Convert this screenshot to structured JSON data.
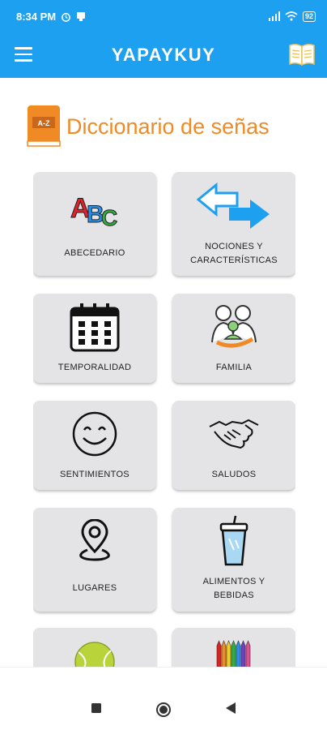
{
  "status_bar": {
    "time": "8:34 PM",
    "battery": "92"
  },
  "app_bar": {
    "title": "YAPAYKUY"
  },
  "header": {
    "title": "Diccionario de señas",
    "book_icon_text": "A-Z"
  },
  "cards": [
    {
      "label": "ABECEDARIO",
      "icon": "abc-letters-icon"
    },
    {
      "label_lines": [
        "NOCIONES Y",
        "CARACTERÍSTICAS"
      ],
      "icon": "arrows-exchange-icon"
    },
    {
      "label": "TEMPORALIDAD",
      "icon": "calendar-icon"
    },
    {
      "label": "FAMILIA",
      "icon": "family-icon"
    },
    {
      "label": "SENTIMIENTOS",
      "icon": "smiley-icon"
    },
    {
      "label": "SALUDOS",
      "icon": "handshake-icon"
    },
    {
      "label": "LUGARES",
      "icon": "location-pin-icon"
    },
    {
      "label_lines": [
        "ALIMENTOS Y",
        "BEBIDAS"
      ],
      "icon": "drink-cup-icon"
    },
    {
      "label": "",
      "icon": "tennis-ball-icon"
    },
    {
      "label": "",
      "icon": "crayons-icon"
    }
  ],
  "colors": {
    "primary": "#1ea0f0",
    "accent": "#f08a24",
    "card": "#e4e4e6"
  }
}
